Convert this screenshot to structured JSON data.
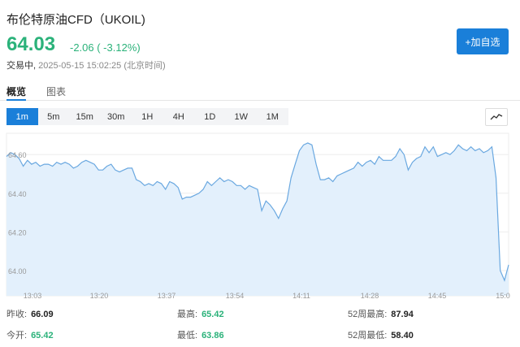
{
  "header": {
    "title": "布伦特原油CFD（UKOIL)",
    "price": "64.03",
    "change": "-2.06 ( -3.12%)",
    "status_label": "交易中,",
    "timestamp": "2025-05-15 15:02:25 (北京时间)",
    "add_watch_label": "+加自选"
  },
  "tabs": [
    {
      "label": "概览",
      "active": true
    },
    {
      "label": "图表",
      "active": false
    }
  ],
  "intervals": [
    "1m",
    "5m",
    "15m",
    "30m",
    "1H",
    "4H",
    "1D",
    "1W",
    "1M"
  ],
  "active_interval": "1m",
  "colors": {
    "accent": "#1a7fd9",
    "down": "#2bb27a",
    "line": "#6aa8e0",
    "fill": "#e3f0fc"
  },
  "chart_data": {
    "type": "area",
    "y_ticks": [
      "64.60",
      "64.40",
      "64.20",
      "64.00"
    ],
    "x_ticks": [
      "13:03",
      "13:20",
      "13:37",
      "13:54",
      "14:11",
      "14:28",
      "14:45",
      "15:0"
    ],
    "ylim": [
      63.87,
      64.71
    ],
    "xlim": [
      0,
      120
    ],
    "x": [
      0,
      1,
      2,
      3,
      4,
      5,
      6,
      7,
      8,
      9,
      10,
      11,
      12,
      13,
      14,
      15,
      16,
      17,
      18,
      19,
      20,
      21,
      22,
      23,
      24,
      25,
      26,
      27,
      28,
      29,
      30,
      31,
      32,
      33,
      34,
      35,
      36,
      37,
      38,
      39,
      40,
      41,
      42,
      43,
      44,
      45,
      46,
      47,
      48,
      49,
      50,
      51,
      52,
      53,
      54,
      55,
      56,
      57,
      58,
      59,
      60,
      61,
      62,
      63,
      64,
      65,
      66,
      67,
      68,
      69,
      70,
      71,
      72,
      73,
      74,
      75,
      76,
      77,
      78,
      79,
      80,
      81,
      82,
      83,
      84,
      85,
      86,
      87,
      88,
      89,
      90,
      91,
      92,
      93,
      94,
      95,
      96,
      97,
      98,
      99,
      100,
      101,
      102,
      103,
      104,
      105,
      106,
      107,
      108,
      109,
      110,
      111,
      112,
      113,
      114,
      115,
      116,
      117,
      118,
      119,
      120
    ],
    "y": [
      64.59,
      64.61,
      64.6,
      64.58,
      64.54,
      64.57,
      64.55,
      64.56,
      64.54,
      64.55,
      64.55,
      64.54,
      64.56,
      64.55,
      64.56,
      64.55,
      64.53,
      64.54,
      64.56,
      64.57,
      64.56,
      64.55,
      64.52,
      64.52,
      64.54,
      64.55,
      64.52,
      64.51,
      64.52,
      64.53,
      64.53,
      64.47,
      64.46,
      64.44,
      64.45,
      64.44,
      64.46,
      64.45,
      64.42,
      64.46,
      64.45,
      64.43,
      64.37,
      64.38,
      64.38,
      64.39,
      64.4,
      64.42,
      64.46,
      64.44,
      64.46,
      64.48,
      64.46,
      64.47,
      64.46,
      64.44,
      64.44,
      64.42,
      64.44,
      64.43,
      64.42,
      64.31,
      64.36,
      64.34,
      64.31,
      64.27,
      64.32,
      64.36,
      64.48,
      64.55,
      64.62,
      64.65,
      64.66,
      64.65,
      64.55,
      64.47,
      64.47,
      64.48,
      64.46,
      64.49,
      64.5,
      64.51,
      64.52,
      64.53,
      64.56,
      64.54,
      64.56,
      64.57,
      64.55,
      64.59,
      64.57,
      64.57,
      64.57,
      64.59,
      64.63,
      64.6,
      64.52,
      64.56,
      64.58,
      64.59,
      64.64,
      64.61,
      64.64,
      64.59,
      64.6,
      64.61,
      64.6,
      64.62,
      64.65,
      64.63,
      64.62,
      64.64,
      64.62,
      64.63,
      64.61,
      64.62,
      64.64,
      64.48,
      64.0,
      63.95,
      64.03,
      64.02
    ]
  },
  "stats": [
    {
      "label": "昨收:",
      "value": "66.09",
      "tone": "dark"
    },
    {
      "label": "最高:",
      "value": "65.42",
      "tone": "green"
    },
    {
      "label": "52周最高:",
      "value": "87.94",
      "tone": "dark"
    },
    {
      "label": "今开:",
      "value": "65.42",
      "tone": "green"
    },
    {
      "label": "最低:",
      "value": "63.86",
      "tone": "green"
    },
    {
      "label": "52周最低:",
      "value": "58.40",
      "tone": "dark"
    }
  ]
}
